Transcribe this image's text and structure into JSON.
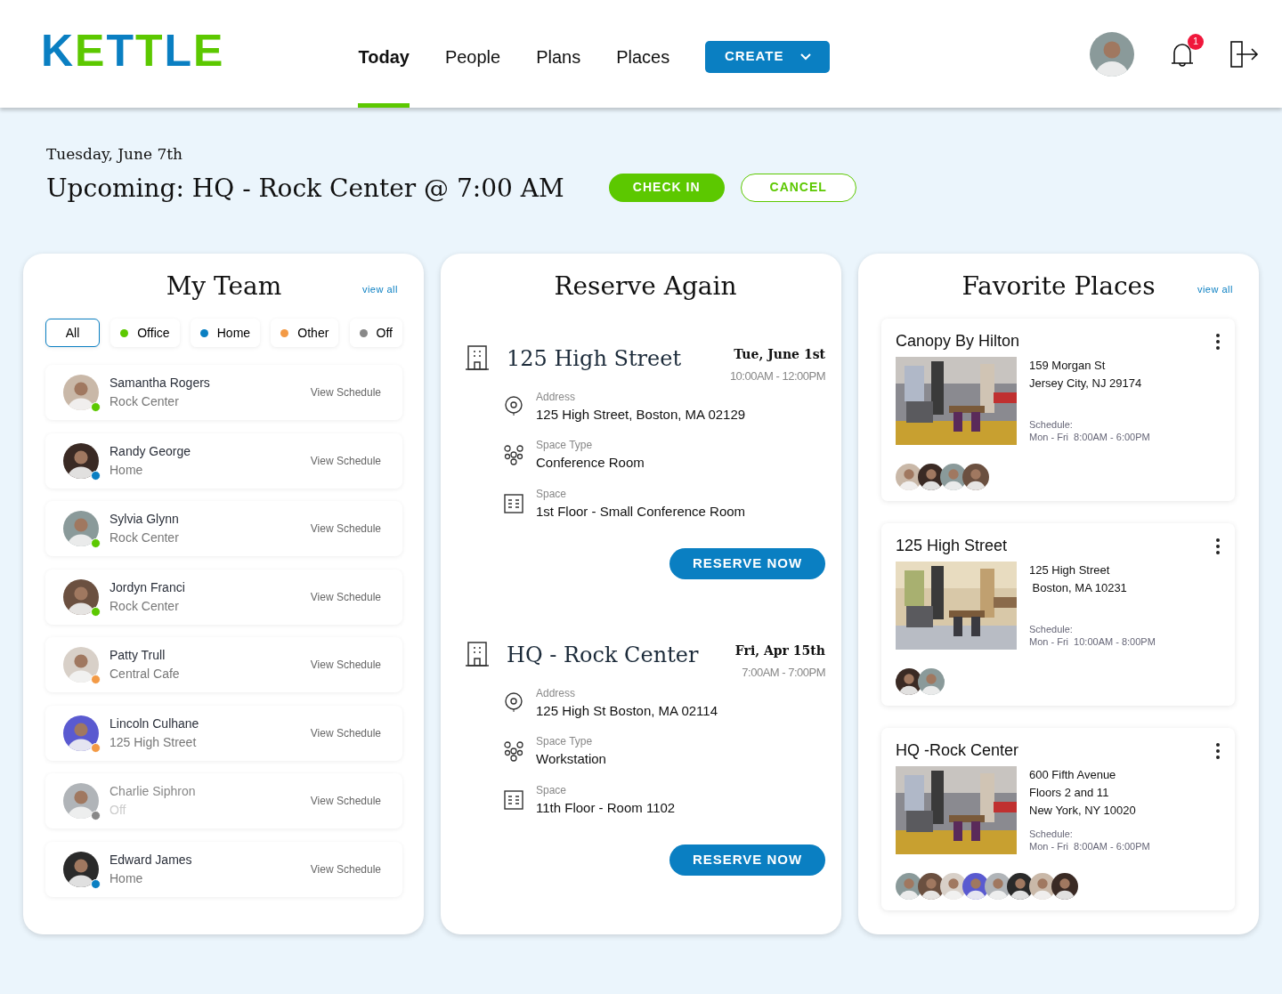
{
  "header": {
    "logo": "KETTLE",
    "tabs": [
      {
        "label": "Today",
        "selected": true
      },
      {
        "label": "People",
        "selected": false
      },
      {
        "label": "Plans",
        "selected": false
      },
      {
        "label": "Places",
        "selected": false
      }
    ],
    "create_button": "CREATE",
    "notification_count": "1"
  },
  "upcoming": {
    "date": "Tuesday, June 7th",
    "title": "Upcoming: HQ - Rock Center @ 7:00 AM",
    "check_in": "CHECK IN",
    "cancel": "CANCEL"
  },
  "my_team": {
    "title": "My Team",
    "view_all": "view all",
    "filters": [
      {
        "label": "All",
        "selected": true
      },
      {
        "label": "Office",
        "selected": false,
        "color": "#5cc800"
      },
      {
        "label": "Home",
        "selected": false,
        "color": "#0a7fc2"
      },
      {
        "label": "Other",
        "selected": false,
        "color": "#f39a45"
      },
      {
        "label": "Off",
        "selected": false,
        "color": "#888888"
      }
    ],
    "members": [
      {
        "name": "Samantha Rogers",
        "location": "Rock Center",
        "color": "#5cc800",
        "dimmed": false,
        "link": "View Schedule"
      },
      {
        "name": "Randy George",
        "location": "Home",
        "color": "#0a7fc2",
        "dimmed": false,
        "link": "View Schedule"
      },
      {
        "name": "Sylvia Glynn",
        "location": "Rock Center",
        "color": "#5cc800",
        "dimmed": false,
        "link": "View Schedule"
      },
      {
        "name": "Jordyn Franci",
        "location": "Rock Center",
        "color": "#5cc800",
        "dimmed": false,
        "link": "View Schedule"
      },
      {
        "name": "Patty Trull",
        "location": "Central Cafe",
        "color": "#f39a45",
        "dimmed": false,
        "link": "View Schedule"
      },
      {
        "name": "Lincoln Culhane",
        "location": "125 High Street",
        "color": "#f39a45",
        "dimmed": false,
        "link": "View Schedule"
      },
      {
        "name": "Charlie Siphron",
        "location": "Off",
        "color": "#888888",
        "dimmed": true,
        "link": "View Schedule"
      },
      {
        "name": "Edward James",
        "location": "Home",
        "color": "#0a7fc2",
        "dimmed": false,
        "link": "View Schedule"
      }
    ]
  },
  "reserve_again": {
    "title": "Reserve Again",
    "bookings": [
      {
        "place": "125 High Street",
        "date": "Tue, June 1st",
        "time": "10:00AM - 12:00PM",
        "fields": [
          {
            "kind": "address",
            "label": "Address",
            "value": "125 High Street, Boston, MA 02129"
          },
          {
            "kind": "space_type",
            "label": "Space Type",
            "value": "Conference Room"
          },
          {
            "kind": "space",
            "label": "Space",
            "value": "1st Floor - Small Conference Room"
          }
        ],
        "button": "RESERVE NOW"
      },
      {
        "place": "HQ - Rock Center",
        "date": "Fri, Apr 15th",
        "time": "7:00AM - 7:00PM",
        "fields": [
          {
            "kind": "address",
            "label": "Address",
            "value": "125 High St Boston, MA 02114"
          },
          {
            "kind": "space_type",
            "label": "Space Type",
            "value": "Workstation"
          },
          {
            "kind": "space",
            "label": "Space",
            "value": "11th Floor - Room 1102"
          }
        ],
        "button": "RESERVE NOW"
      }
    ]
  },
  "favorite_places": {
    "title": "Favorite Places",
    "view_all": "view all",
    "places": [
      {
        "name": "Canopy By Hilton",
        "address": [
          "159 Morgan St",
          "Jersey City, NJ 29174"
        ],
        "schedule_label": "Schedule:",
        "schedule": "Mon - Fri  8:00AM - 6:00PM",
        "attendees": [
          {
            "kind": "avatar"
          },
          {
            "kind": "avatar"
          },
          {
            "kind": "avatar"
          },
          {
            "kind": "avatar"
          }
        ]
      },
      {
        "name": "125 High Street",
        "address": [
          "125 High Street",
          " Boston, MA 10231"
        ],
        "schedule_label": "Schedule:",
        "schedule": "Mon - Fri  10:00AM - 8:00PM",
        "attendees": [
          {
            "kind": "avatar"
          },
          {
            "kind": "avatar"
          }
        ]
      },
      {
        "name": "HQ -Rock Center",
        "address": [
          "600 Fifth Avenue",
          "Floors 2 and 11",
          "New York, NY 10020"
        ],
        "schedule_label": "Schedule:",
        "schedule": "Mon - Fri  8:00AM - 6:00PM",
        "attendees": [
          {
            "kind": "avatar"
          },
          {
            "kind": "avatar"
          },
          {
            "kind": "avatar"
          },
          {
            "kind": "avatar"
          },
          {
            "kind": "avatar"
          },
          {
            "kind": "avatar"
          },
          {
            "kind": "avatar"
          },
          {
            "kind": "avatar"
          }
        ]
      }
    ]
  }
}
